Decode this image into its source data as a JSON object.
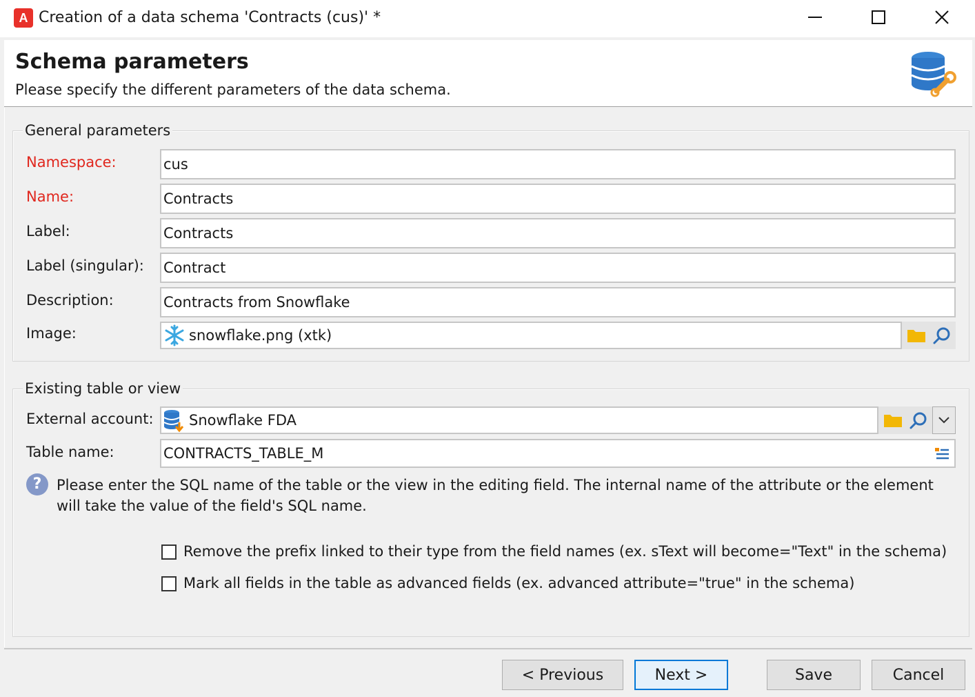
{
  "window": {
    "title": "Creation of a data schema 'Contracts (cus)' *",
    "app_icon_letter": "A"
  },
  "header": {
    "title": "Schema parameters",
    "subtitle": "Please specify the different parameters of the data schema.",
    "icon": "database-wrench-icon"
  },
  "general": {
    "group_label": "General parameters",
    "namespace_label": "Namespace:",
    "namespace_value": "cus",
    "name_label": "Name:",
    "name_value": "Contracts",
    "label_label": "Label:",
    "label_value": "Contracts",
    "singular_label": "Label (singular):",
    "singular_value": "Contract",
    "description_label": "Description:",
    "description_value": "Contracts from Snowflake",
    "image_label": "Image:",
    "image_value": "snowflake.png (xtk)"
  },
  "existing": {
    "group_label": "Existing table or view",
    "external_account_label": "External account:",
    "external_account_value": "Snowflake FDA",
    "table_name_label": "Table name:",
    "table_name_value": "CONTRACTS_TABLE_M",
    "help_text": "Please enter the SQL name of the table or the view in the editing field. The internal name of the attribute or the element will take the value of the field's SQL name.",
    "checkbox1_label": "Remove the prefix linked to their type from the field names (ex. sText will become=\"Text\" in the schema)",
    "checkbox1_checked": false,
    "checkbox2_label": "Mark all fields in the table as advanced fields (ex. advanced attribute=\"true\" in the schema)",
    "checkbox2_checked": false
  },
  "buttons": {
    "previous": "< Previous",
    "next": "Next >",
    "save": "Save",
    "cancel": "Cancel"
  },
  "colors": {
    "required_label": "#e0271e",
    "app_icon": "#e8312a",
    "default_button_border": "#0078d7",
    "folder": "#f2b705",
    "search": "#2d6fb8"
  }
}
